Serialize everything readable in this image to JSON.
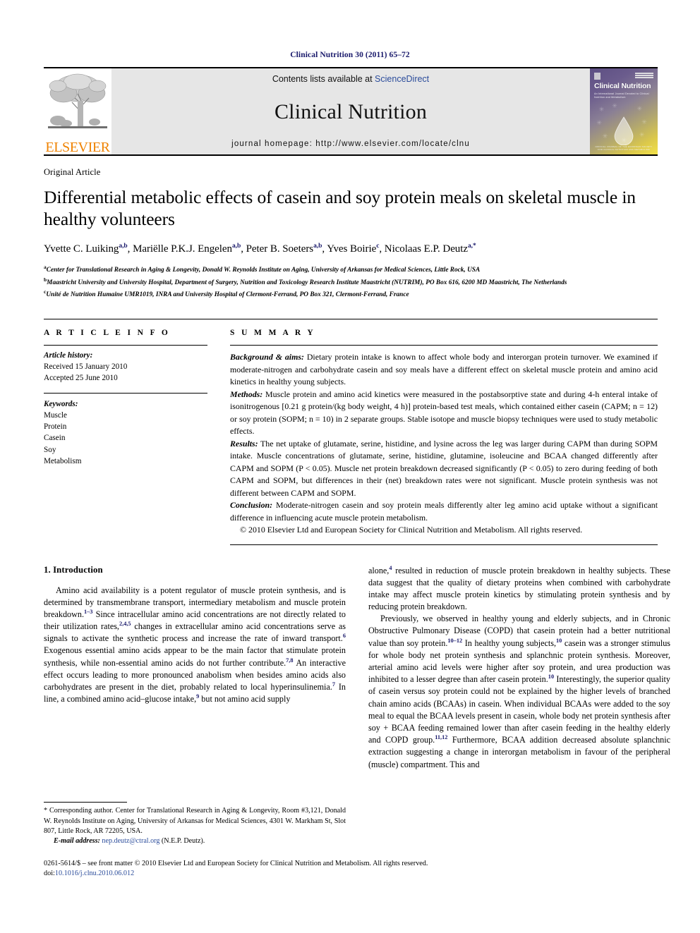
{
  "running_head": "Clinical Nutrition 30 (2011) 65–72",
  "masthead": {
    "publisher_name": "ELSEVIER",
    "contents_prefix": "Contents lists available at ",
    "contents_link": "ScienceDirect",
    "journal_title": "Clinical Nutrition",
    "homepage": "journal homepage: http://www.elsevier.com/locate/clnu",
    "cover": {
      "title": "Clinical Nutrition",
      "subtitle": "An International Journal Devoted to Clinical Nutrition and Metabolism",
      "footer": "OFFICIAL JOURNAL OF THE EUROPEAN SOCIETY FOR CLINICAL NUTRITION AND METABOLISM"
    }
  },
  "article": {
    "type": "Original Article",
    "title": "Differential metabolic effects of casein and soy protein meals on skeletal muscle in healthy volunteers",
    "authors": [
      {
        "name": "Yvette C. Luiking",
        "marks": "a,b"
      },
      {
        "name": "Mariëlle P.K.J. Engelen",
        "marks": "a,b"
      },
      {
        "name": "Peter B. Soeters",
        "marks": "a,b"
      },
      {
        "name": "Yves Boirie",
        "marks": "c"
      },
      {
        "name": "Nicolaas E.P. Deutz",
        "marks": "a,*"
      }
    ],
    "affiliations": [
      {
        "mark": "a",
        "text": "Center for Translational Research in Aging & Longevity, Donald W. Reynolds Institute on Aging, University of Arkansas for Medical Sciences, Little Rock, USA"
      },
      {
        "mark": "b",
        "text": "Maastricht University and University Hospital, Department of Surgery, Nutrition and Toxicology Research Institute Maastricht (NUTRIM), PO Box 616, 6200 MD Maastricht, The Netherlands"
      },
      {
        "mark": "c",
        "text": "Unité de Nutrition Humaine UMR1019, INRA and University Hospital of Clermont-Ferrand, PO Box 321, Clermont-Ferrand, France"
      }
    ]
  },
  "article_info": {
    "heading": "A R T I C L E   I N F O",
    "history_label": "Article history:",
    "received": "Received 15 January 2010",
    "accepted": "Accepted 25 June 2010",
    "keywords_label": "Keywords:",
    "keywords": [
      "Muscle",
      "Protein",
      "Casein",
      "Soy",
      "Metabolism"
    ]
  },
  "summary": {
    "heading": "S U M M A R Y",
    "background_label": "Background & aims:",
    "background_text": " Dietary protein intake is known to affect whole body and interorgan protein turnover. We examined if moderate-nitrogen and carbohydrate casein and soy meals have a different effect on skeletal muscle protein and amino acid kinetics in healthy young subjects.",
    "methods_label": "Methods:",
    "methods_text": " Muscle protein and amino acid kinetics were measured in the postabsorptive state and during 4-h enteral intake of isonitrogenous [0.21 g protein/(kg body weight, 4 h)] protein-based test meals, which contained either casein (CAPM; n = 12) or soy protein (SOPM; n = 10) in 2 separate groups. Stable isotope and muscle biopsy techniques were used to study metabolic effects.",
    "results_label": "Results:",
    "results_text": " The net uptake of glutamate, serine, histidine, and lysine across the leg was larger during CAPM than during SOPM intake. Muscle concentrations of glutamate, serine, histidine, glutamine, isoleucine and BCAA changed differently after CAPM and SOPM (P < 0.05). Muscle net protein breakdown decreased significantly (P < 0.05) to zero during feeding of both CAPM and SOPM, but differences in their (net) breakdown rates were not significant. Muscle protein synthesis was not different between CAPM and SOPM.",
    "conclusion_label": "Conclusion:",
    "conclusion_text": " Moderate-nitrogen casein and soy protein meals differently alter leg amino acid uptake without a significant difference in influencing acute muscle protein metabolism.",
    "copyright": "© 2010 Elsevier Ltd and European Society for Clinical Nutrition and Metabolism. All rights reserved."
  },
  "introduction": {
    "heading": "1. Introduction",
    "left_paragraph_1": "Amino acid availability is a potent regulator of muscle protein synthesis, and is determined by transmembrane transport, intermediary metabolism and muscle protein breakdown.",
    "ref_1_3": "1–3",
    "left_paragraph_1b": " Since intracellular amino acid concentrations are not directly related to their utilization rates,",
    "ref_2_4_5": "2,4,5",
    "left_paragraph_1c": " changes in extracellular amino acid concentrations serve as signals to activate the synthetic process and increase the rate of inward transport.",
    "ref_6": "6",
    "left_paragraph_1d": " Exogenous essential amino acids appear to be the main factor that stimulate protein synthesis, while non-essential amino acids do not further contribute.",
    "ref_7_8": "7,8",
    "left_paragraph_1e": " An interactive effect occurs leading to more pronounced anabolism when besides amino acids also carbohydrates are present in the diet, probably related to local hyperinsulinemia.",
    "ref_7": "7",
    "left_paragraph_1f": " In line, a combined amino acid–glucose intake,",
    "ref_9": "9",
    "left_paragraph_1g": " but not amino acid supply",
    "right_paragraph_1a": "alone,",
    "ref_4": "4",
    "right_paragraph_1b": " resulted in reduction of muscle protein breakdown in healthy subjects. These data suggest that the quality of dietary proteins when combined with carbohydrate intake may affect muscle protein kinetics by stimulating protein synthesis and by reducing protein breakdown.",
    "right_paragraph_2a": "Previously, we observed in healthy young and elderly subjects, and in Chronic Obstructive Pulmonary Disease (COPD) that casein protein had a better nutritional value than soy protein.",
    "ref_10_12": "10–12",
    "right_paragraph_2b": " In healthy young subjects,",
    "ref_10": "10",
    "right_paragraph_2c": " casein was a stronger stimulus for whole body net protein synthesis and splanchnic protein synthesis. Moreover, arterial amino acid levels were higher after soy protein, and urea production was inhibited to a lesser degree than after casein protein.",
    "ref_10b": "10",
    "right_paragraph_2d": " Interestingly, the superior quality of casein versus soy protein could not be explained by the higher levels of branched chain amino acids (BCAAs) in casein. When individual BCAAs were added to the soy meal to equal the BCAA levels present in casein, whole body net protein synthesis after soy + BCAA feeding remained lower than after casein feeding in the healthy elderly and COPD group.",
    "ref_11_12": "11,12",
    "right_paragraph_2e": " Furthermore, BCAA addition decreased absolute splanchnic extraction suggesting a change in interorgan metabolism in favour of the peripheral (muscle) compartment. This and"
  },
  "footnotes": {
    "corresponding_marker": "*",
    "corresponding_text": " Corresponding author. Center for Translational Research in Aging & Longevity, Room #3,121, Donald W. Reynolds Institute on Aging, University of Arkansas for Medical Sciences, 4301 W. Markham St, Slot 807, Little Rock, AR 72205, USA.",
    "email_label": "E-mail address:",
    "email": "nep.deutz@ctral.org",
    "email_attrib": " (N.E.P. Deutz).",
    "imprint_line": "0261-5614/$ – see front matter © 2010 Elsevier Ltd and European Society for Clinical Nutrition and Metabolism. All rights reserved.",
    "doi_label": "doi:",
    "doi": "10.1016/j.clnu.2010.06.012"
  }
}
